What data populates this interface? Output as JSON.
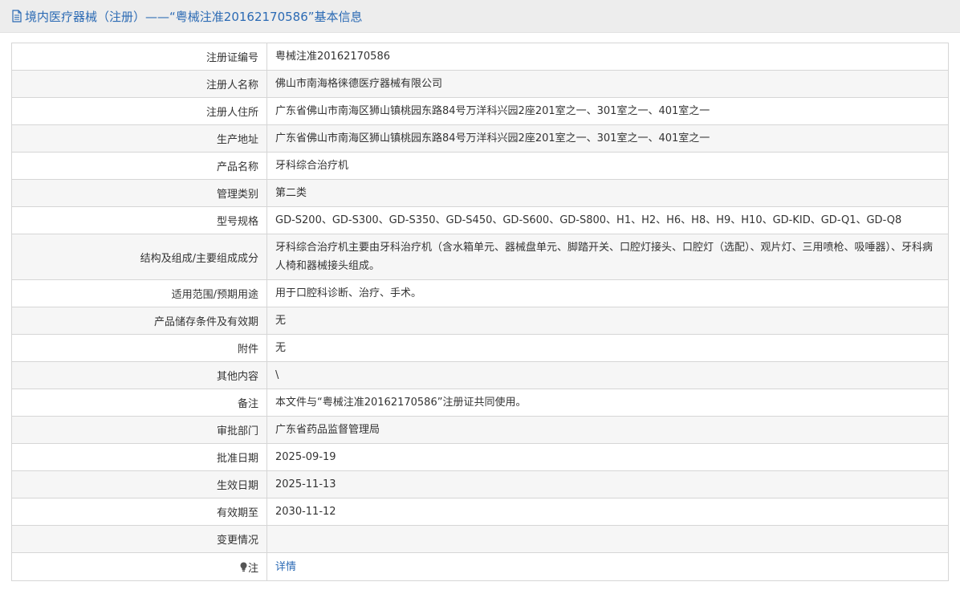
{
  "header": {
    "title": "境内医疗器械（注册）——“粤械注准20162170586”基本信息",
    "icon": "document-icon"
  },
  "rows": [
    {
      "label": "注册证编号",
      "value": "粤械注准20162170586"
    },
    {
      "label": "注册人名称",
      "value": "佛山市南海格徕德医疗器械有限公司"
    },
    {
      "label": "注册人住所",
      "value": "广东省佛山市南海区狮山镇桃园东路84号万洋科兴园2座201室之一、301室之一、401室之一"
    },
    {
      "label": "生产地址",
      "value": "广东省佛山市南海区狮山镇桃园东路84号万洋科兴园2座201室之一、301室之一、401室之一"
    },
    {
      "label": "产品名称",
      "value": "牙科综合治疗机"
    },
    {
      "label": "管理类别",
      "value": "第二类"
    },
    {
      "label": "型号规格",
      "value": "GD-S200、GD-S300、GD-S350、GD-S450、GD-S600、GD-S800、H1、H2、H6、H8、H9、H10、GD-KID、GD-Q1、GD-Q8"
    },
    {
      "label": "结构及组成/主要组成成分",
      "value": "牙科综合治疗机主要由牙科治疗机（含水箱单元、器械盘单元、脚踏开关、口腔灯接头、口腔灯（选配）、观片灯、三用喷枪、吸唾器）、牙科病人椅和器械接头组成。"
    },
    {
      "label": "适用范围/预期用途",
      "value": "用于口腔科诊断、治疗、手术。"
    },
    {
      "label": "产品储存条件及有效期",
      "value": "无"
    },
    {
      "label": "附件",
      "value": "无"
    },
    {
      "label": "其他内容",
      "value": "\\"
    },
    {
      "label": "备注",
      "value": "本文件与“粤械注准20162170586”注册证共同使用。"
    },
    {
      "label": "审批部门",
      "value": "广东省药品监督管理局"
    },
    {
      "label": "批准日期",
      "value": "2025-09-19"
    },
    {
      "label": "生效日期",
      "value": "2025-11-13"
    },
    {
      "label": "有效期至",
      "value": "2030-11-12"
    },
    {
      "label": "变更情况",
      "value": ""
    }
  ],
  "note": {
    "label": "注",
    "icon": "lightbulb-icon",
    "link": "详情"
  },
  "colors": {
    "accent": "#2b6ab4",
    "header_bg": "#ededed",
    "row_alt_bg": "#f6f6f6",
    "border": "#d6d6d6"
  }
}
